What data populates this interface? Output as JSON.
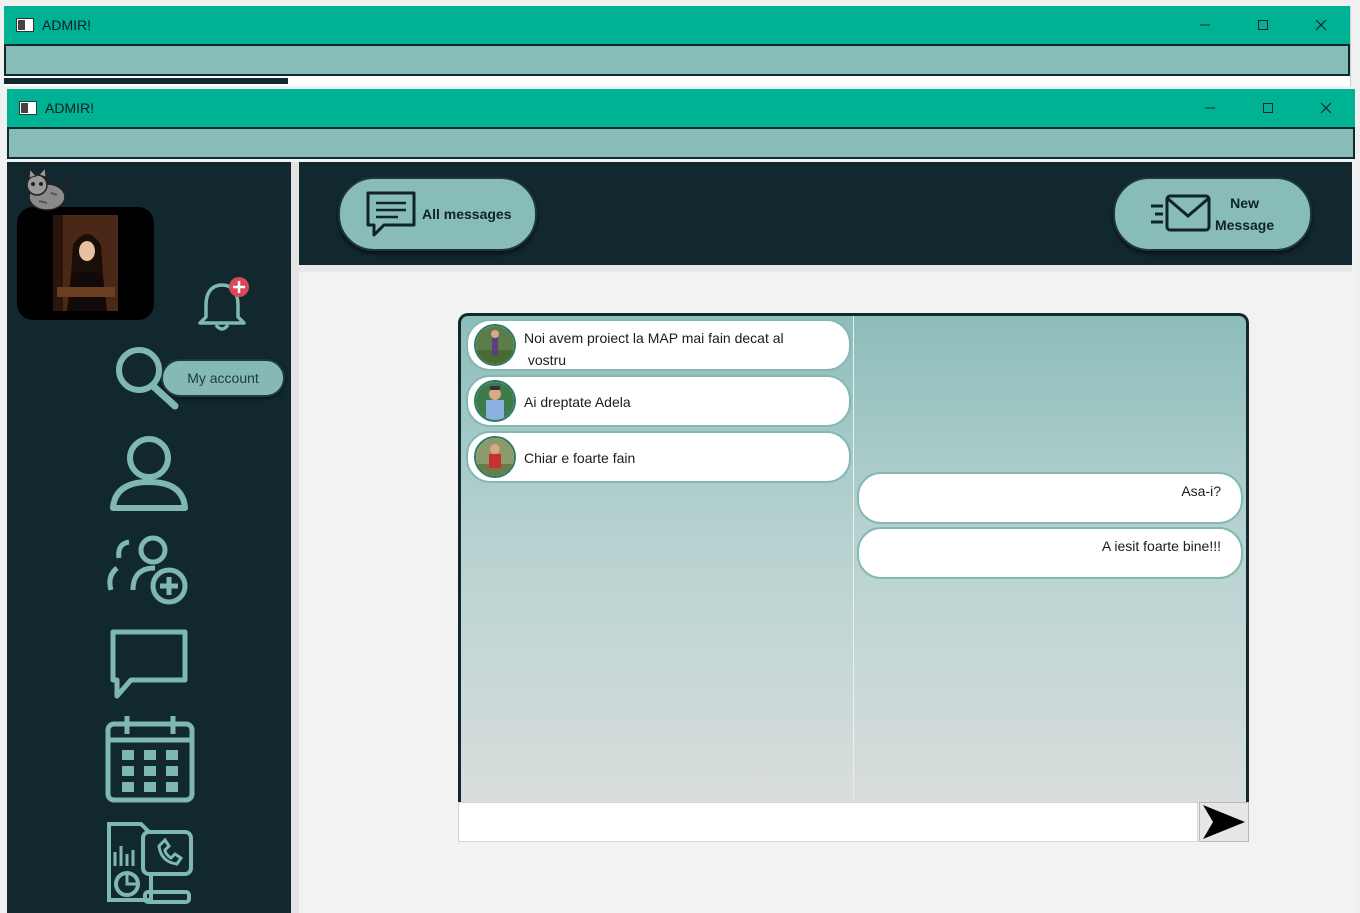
{
  "back_window": {
    "title": "ADMIR!"
  },
  "window": {
    "title": "ADMIR!"
  },
  "sidebar": {
    "account_label": "My account",
    "icons": [
      "search-icon",
      "user-icon",
      "add-group-icon",
      "chat-icon",
      "calendar-icon",
      "report-icon"
    ]
  },
  "topbar": {
    "all_messages_label": "All messages",
    "new_message_line1": "New",
    "new_message_line2": "Message"
  },
  "chat": {
    "received": [
      {
        "line1": "Noi avem proiect la MAP mai fain decat al",
        "line2": " vostru"
      },
      {
        "line1": "Ai dreptate Adela",
        "line2": ""
      },
      {
        "line1": "Chiar e foarte fain",
        "line2": ""
      }
    ],
    "sent": [
      {
        "text": "Asa-i?"
      },
      {
        "text": "A iesit foarte bine!!!"
      }
    ],
    "input_value": ""
  },
  "colors": {
    "title_bar": "#00b294",
    "sidebar_bg": "#12282f",
    "accent": "#87bcb9"
  }
}
